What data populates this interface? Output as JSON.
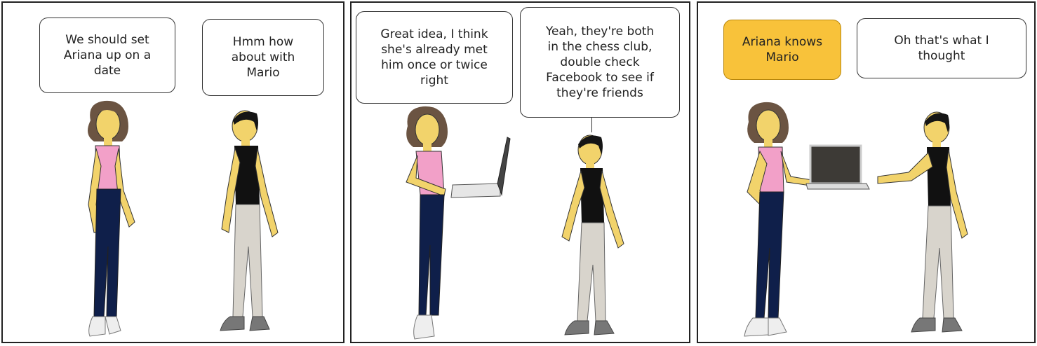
{
  "panels": [
    {
      "bubbles": [
        {
          "text": "We should set\nAriana up on a\ndate",
          "style": "white"
        },
        {
          "text": "Hmm how\nabout with\nMario",
          "style": "white"
        }
      ]
    },
    {
      "bubbles": [
        {
          "text": "Great idea, I think\nshe's already met\nhim once or twice\nright",
          "style": "white"
        },
        {
          "text": "Yeah, they're both\nin the chess club,\ndouble check\nFacebook to see if\nthey're friends",
          "style": "white"
        }
      ]
    },
    {
      "bubbles": [
        {
          "text": "Ariana knows\nMario",
          "style": "yellow",
          "color": "#f8c23a"
        },
        {
          "text": "Oh that's what I\nthought",
          "style": "white"
        }
      ]
    }
  ],
  "colors": {
    "skin": "#f2d36b",
    "shirt_girl": "#f2a0c8",
    "shirt_boy": "#111111",
    "jeans": "#0f1f4a",
    "pants_boy": "#d8d4cc",
    "hair_girl": "#6b5442",
    "hair_boy": "#151515"
  }
}
